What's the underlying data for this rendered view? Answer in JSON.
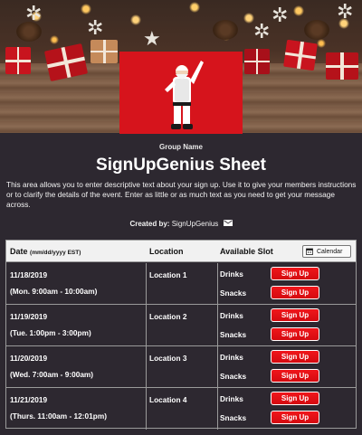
{
  "banner": {
    "photo_alt": "santa-photo"
  },
  "header": {
    "group_name": "Group Name",
    "title": "SignUpGenius Sheet",
    "description": "This area allows you to enter descriptive text about your sign up. Use it to give your members instructions or to clarify the details of the event. Enter as little or as much text as you need to get your message across.",
    "created_by_label": "Created by:",
    "created_by_name": "SignUpGenius"
  },
  "table": {
    "columns": {
      "date": "Date",
      "date_hint": "(mm/dd/yyyy EST)",
      "location": "Location",
      "slot": "Available Slot",
      "calendar_button": "Calendar"
    },
    "rows": [
      {
        "date": "11/18/2019",
        "time": "(Mon. 9:00am - 10:00am)",
        "location": "Location 1",
        "slots": [
          {
            "item": "Drinks",
            "action": "Sign Up"
          },
          {
            "item": "Snacks",
            "action": "Sign Up"
          }
        ]
      },
      {
        "date": "11/19/2019",
        "time": "(Tue. 1:00pm - 3:00pm)",
        "location": "Location 2",
        "slots": [
          {
            "item": "Drinks",
            "action": "Sign Up"
          },
          {
            "item": "Snacks",
            "action": "Sign Up"
          }
        ]
      },
      {
        "date": "11/20/2019",
        "time": "(Wed. 7:00am - 9:00am)",
        "location": "Location 3",
        "slots": [
          {
            "item": "Drinks",
            "action": "Sign Up"
          },
          {
            "item": "Snacks",
            "action": "Sign Up"
          }
        ]
      },
      {
        "date": "11/21/2019",
        "time": "(Thurs. 11:00am - 12:01pm)",
        "location": "Location 4",
        "slots": [
          {
            "item": "Drinks",
            "action": "Sign Up"
          },
          {
            "item": "Snacks",
            "action": "Sign Up"
          }
        ]
      }
    ]
  },
  "colors": {
    "background": "#2d2830",
    "signup_button": "#e0111a",
    "header_row": "#f1f1f1"
  },
  "icons": {
    "mail": "envelope-icon",
    "calendar": "calendar-icon"
  }
}
